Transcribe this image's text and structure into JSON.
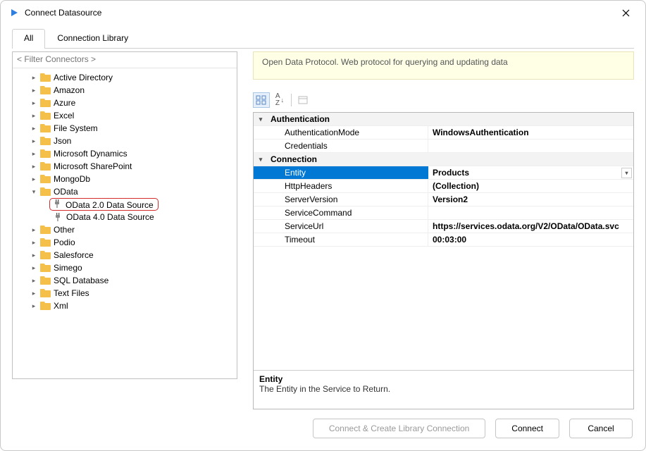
{
  "window": {
    "title": "Connect Datasource"
  },
  "tabs": {
    "all": "All",
    "library": "Connection Library"
  },
  "filter": {
    "placeholder": "< Filter Connectors >"
  },
  "tree": {
    "folders": [
      {
        "label": "Active Directory",
        "expanded": false
      },
      {
        "label": "Amazon",
        "expanded": false
      },
      {
        "label": "Azure",
        "expanded": false
      },
      {
        "label": "Excel",
        "expanded": false
      },
      {
        "label": "File System",
        "expanded": false
      },
      {
        "label": "Json",
        "expanded": false
      },
      {
        "label": "Microsoft Dynamics",
        "expanded": false
      },
      {
        "label": "Microsoft SharePoint",
        "expanded": false
      },
      {
        "label": "MongoDb",
        "expanded": false
      },
      {
        "label": "OData",
        "expanded": true,
        "children": [
          {
            "label": "OData 2.0 Data Source",
            "highlighted": true
          },
          {
            "label": "OData 4.0 Data Source",
            "highlighted": false
          }
        ]
      },
      {
        "label": "Other",
        "expanded": false
      },
      {
        "label": "Podio",
        "expanded": false
      },
      {
        "label": "Salesforce",
        "expanded": false
      },
      {
        "label": "Simego",
        "expanded": false
      },
      {
        "label": "SQL Database",
        "expanded": false
      },
      {
        "label": "Text Files",
        "expanded": false
      },
      {
        "label": "Xml",
        "expanded": false
      }
    ]
  },
  "description": "Open Data Protocol. Web protocol for querying and updating data",
  "propgrid": {
    "categories": [
      {
        "name": "Authentication",
        "props": [
          {
            "name": "AuthenticationMode",
            "value": "WindowsAuthentication"
          },
          {
            "name": "Credentials",
            "value": ""
          }
        ]
      },
      {
        "name": "Connection",
        "props": [
          {
            "name": "Entity",
            "value": "Products",
            "selected": true,
            "dropdown": true
          },
          {
            "name": "HttpHeaders",
            "value": "(Collection)"
          },
          {
            "name": "ServerVersion",
            "value": "Version2"
          },
          {
            "name": "ServiceCommand",
            "value": ""
          },
          {
            "name": "ServiceUrl",
            "value": "https://services.odata.org/V2/OData/OData.svc"
          },
          {
            "name": "Timeout",
            "value": "00:03:00"
          }
        ]
      }
    ],
    "help": {
      "title": "Entity",
      "desc": "The Entity in the Service to Return."
    }
  },
  "footer": {
    "createLib": "Connect & Create Library Connection",
    "connect": "Connect",
    "cancel": "Cancel"
  }
}
